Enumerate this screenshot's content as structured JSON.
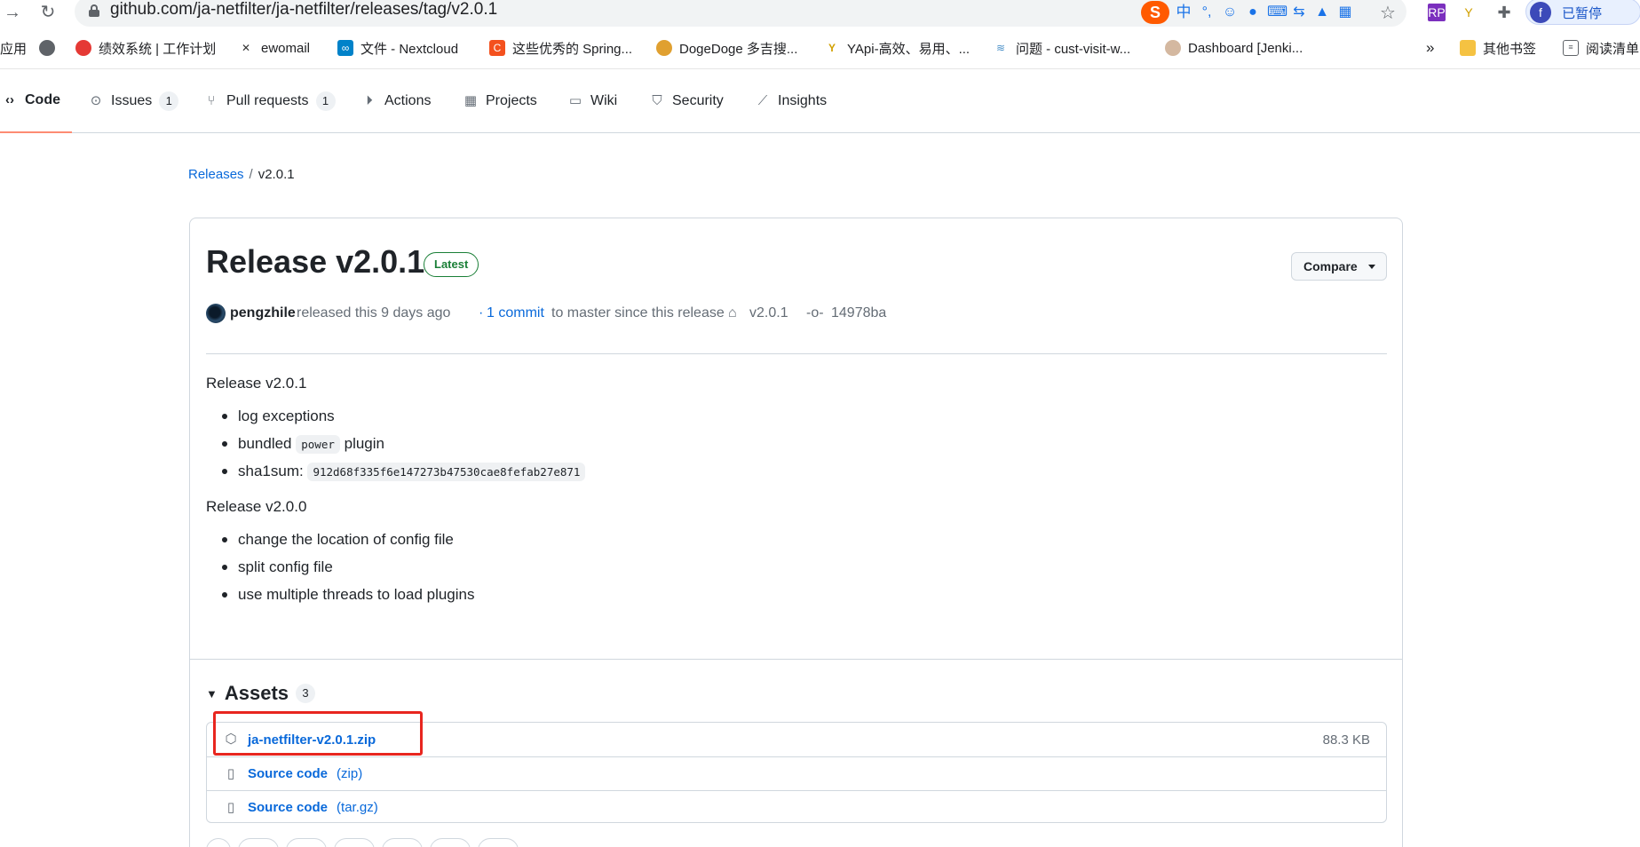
{
  "browser": {
    "url": "github.com/ja-netfilter/ja-netfilter/releases/tag/v2.0.1",
    "profile_label": "已暂停",
    "profile_initial": "f",
    "ime_label": "中",
    "bookmarks": [
      {
        "label": "应用",
        "icon": "apps-icon"
      },
      {
        "label": "",
        "icon": "globe-icon"
      },
      {
        "label": "绩效系统 | 工作计划",
        "icon": "red-logo-icon"
      },
      {
        "label": "ewomail",
        "icon": "ewomail-icon"
      },
      {
        "label": "文件 - Nextcloud",
        "icon": "nextcloud-icon"
      },
      {
        "label": "这些优秀的 Spring...",
        "icon": "c-logo-icon"
      },
      {
        "label": "DogeDoge 多吉搜...",
        "icon": "dogedoge-icon"
      },
      {
        "label": "YApi-高效、易用、...",
        "icon": "yapi-icon"
      },
      {
        "label": "问题 - cust-visit-w...",
        "icon": "wave-icon"
      },
      {
        "label": "Dashboard [Jenki...",
        "icon": "jenkins-icon"
      },
      {
        "label": "»",
        "icon": "more-icon"
      },
      {
        "label": "其他书签",
        "icon": "folder-icon"
      },
      {
        "label": "阅读清单",
        "icon": "reading-list-icon"
      }
    ]
  },
  "repo_nav": {
    "tabs": [
      {
        "label": "Code",
        "icon": "code-icon",
        "selected": true
      },
      {
        "label": "Issues",
        "icon": "issue-icon",
        "count": "1"
      },
      {
        "label": "Pull requests",
        "icon": "pull-request-icon",
        "count": "1"
      },
      {
        "label": "Actions",
        "icon": "play-icon"
      },
      {
        "label": "Projects",
        "icon": "table-icon"
      },
      {
        "label": "Wiki",
        "icon": "book-icon"
      },
      {
        "label": "Security",
        "icon": "shield-icon"
      },
      {
        "label": "Insights",
        "icon": "graph-icon"
      }
    ]
  },
  "breadcrumb": {
    "root": "Releases",
    "separator": "/",
    "current": "v2.0.1"
  },
  "release": {
    "title": "Release v2.0.1",
    "badge": "Latest",
    "compare_label": "Compare",
    "author": "pengzhile",
    "released_text": "released this 9 days ago",
    "commit_prefix": "·",
    "commits_link": "1 commit",
    "commits_suffix": "to master since this release",
    "tag": "v2.0.1",
    "commit_sha": "14978ba",
    "notes": {
      "section1_title": "Release v2.0.1",
      "section1_items": [
        "log exceptions",
        "bundled",
        "power",
        "plugin",
        "sha1sum:",
        "912d68f335f6e147273b47530cae8fefab27e871"
      ],
      "section2_title": "Release v2.0.0",
      "section2_items": [
        "change the location of config file",
        "split config file",
        "use multiple threads to load plugins"
      ]
    }
  },
  "assets": {
    "title": "Assets",
    "count": "3",
    "items": [
      {
        "name": "ja-netfilter-v2.0.1.zip",
        "type": "",
        "size": "88.3 KB",
        "icon": "package-icon"
      },
      {
        "name": "Source code",
        "type": "(zip)",
        "size": "",
        "icon": "file-zip-icon"
      },
      {
        "name": "Source code",
        "type": "(tar.gz)",
        "size": "",
        "icon": "file-zip-icon"
      }
    ]
  },
  "colors": {
    "accent_link": "#0969da",
    "latest_green": "#1a7f37",
    "selected_tab_underline": "#fd8c73",
    "highlight_red": "#e8261f"
  }
}
